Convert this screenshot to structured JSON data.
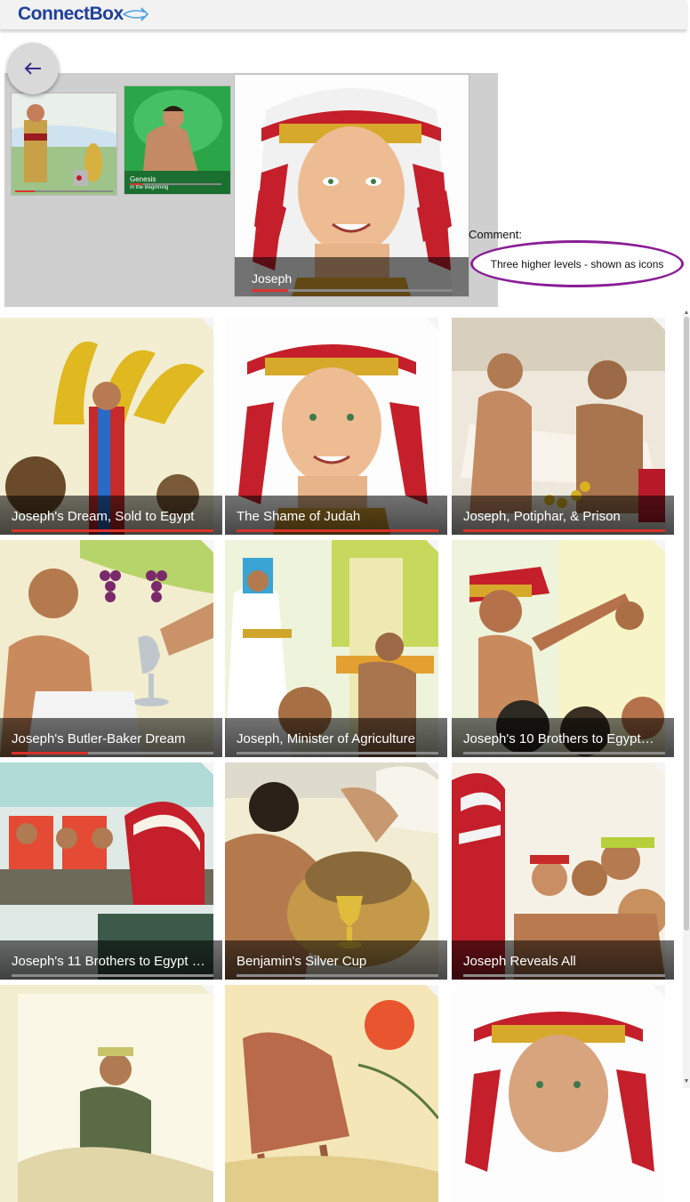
{
  "app": {
    "logo_text": "ConnectBox"
  },
  "breadcrumbs": {
    "back_label": "←",
    "items": [
      {
        "label": "",
        "progress": 0.2
      },
      {
        "label": "Genesis",
        "sublabel": "In the Beginning",
        "progress": 0.15
      },
      {
        "label": "Joseph",
        "progress": 0.18
      }
    ]
  },
  "comment": {
    "label": "Comment:",
    "text": "Three higher levels - shown as icons"
  },
  "tiles": [
    {
      "title": "Joseph's Dream, Sold to Egypt",
      "progress": 1.0
    },
    {
      "title": "The Shame of Judah",
      "progress": 1.0
    },
    {
      "title": "Joseph, Potiphar, & Prison",
      "progress": 1.0
    },
    {
      "title": "Joseph's Butler-Baker Dream",
      "progress": 0.38
    },
    {
      "title": "Joseph, Minister of Agriculture",
      "progress": 0
    },
    {
      "title": "Joseph's 10 Brothers to Egypt…",
      "progress": 0
    },
    {
      "title": "Joseph's 11 Brothers to Egypt …",
      "progress": 0
    },
    {
      "title": "Benjamin's Silver Cup",
      "progress": 0
    },
    {
      "title": "Joseph Reveals All",
      "progress": 0
    },
    {
      "title": "",
      "progress": 0
    },
    {
      "title": "",
      "progress": 0
    },
    {
      "title": "",
      "progress": 0
    }
  ],
  "colors": {
    "accent": "#8a1f96",
    "progress": "#d9322a",
    "logo": "#1f3f9a"
  }
}
